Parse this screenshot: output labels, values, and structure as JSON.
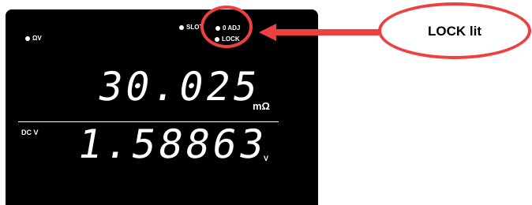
{
  "meter": {
    "indicators": {
      "ohm_v": "ΩV",
      "slot": "SLOT",
      "zero_adj": "0 ADJ",
      "lock": "LOCK"
    },
    "main_reading": {
      "value": "30.025",
      "unit": "mΩ"
    },
    "sub_reading": {
      "label": "DC V",
      "value": "1.58863",
      "unit": "V"
    }
  },
  "annotation": {
    "callout_text": "LOCK lit",
    "color": "#ee4040"
  },
  "colors": {
    "display_background": "#000000",
    "segment": "#ffffff",
    "highlight": "#ee4040"
  }
}
